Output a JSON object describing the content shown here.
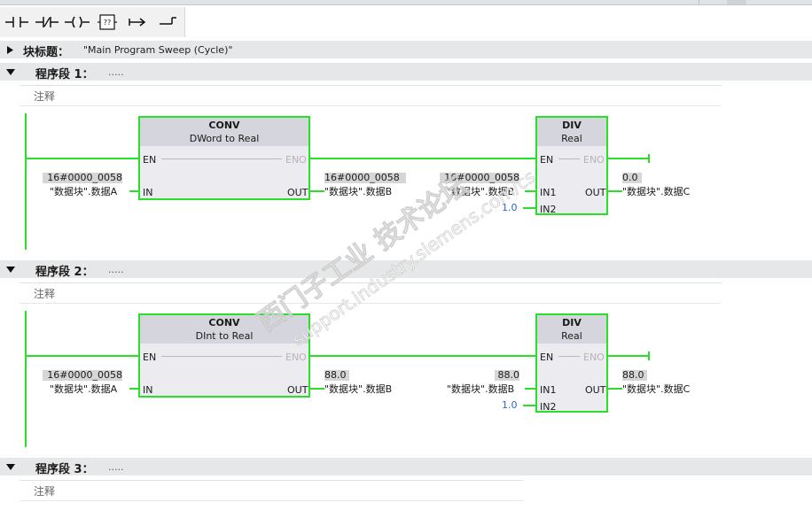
{
  "toolbar": {
    "buttons": [
      {
        "name": "no-contact-icon"
      },
      {
        "name": "nc-contact-icon"
      },
      {
        "name": "coil-icon"
      },
      {
        "name": "empty-box-icon"
      },
      {
        "name": "open-branch-icon"
      },
      {
        "name": "close-branch-icon"
      }
    ],
    "empty_box_glyph": "??"
  },
  "block_title": {
    "label": "块标题：",
    "value": "\"Main Program Sweep (Cycle)\""
  },
  "networks": [
    {
      "label": "程序段 1：",
      "dots": ".....",
      "comment": "注释",
      "conv": {
        "name": "CONV",
        "from": "DWord",
        "to_word": "to",
        "to": "Real",
        "en": "EN",
        "eno": "ENO",
        "in": "IN",
        "out": "OUT"
      },
      "conv_in_value": "16#0000_0058",
      "conv_in_tag": "\"数据块\".数据A",
      "conv_out_value": "16#0000_0058",
      "conv_out_tag": "\"数据块\".数据B",
      "div": {
        "name": "DIV",
        "type": "Real",
        "en": "EN",
        "eno": "ENO",
        "in1": "IN1",
        "in2": "IN2",
        "out": "OUT"
      },
      "div_in1_value": "16#0000_0058",
      "div_in1_tag": "\"数据块\".数据B",
      "div_in2_const": "1.0",
      "div_out_value": "0.0",
      "div_out_tag": "\"数据块\".数据C"
    },
    {
      "label": "程序段 2：",
      "dots": ".....",
      "comment": "注释",
      "conv": {
        "name": "CONV",
        "from": "DInt",
        "to_word": "to",
        "to": "Real",
        "en": "EN",
        "eno": "ENO",
        "in": "IN",
        "out": "OUT"
      },
      "conv_in_value": "16#0000_0058",
      "conv_in_tag": "\"数据块\".数据A",
      "conv_out_value": "88.0",
      "conv_out_tag": "\"数据块\".数据B",
      "div": {
        "name": "DIV",
        "type": "Real",
        "en": "EN",
        "eno": "ENO",
        "in1": "IN1",
        "in2": "IN2",
        "out": "OUT"
      },
      "div_in1_value": "88.0",
      "div_in1_tag": "\"数据块\".数据B",
      "div_in2_const": "1.0",
      "div_out_value": "88.0",
      "div_out_tag": "\"数据块\".数据C"
    },
    {
      "label": "程序段 3：",
      "dots": ".....",
      "comment": "注释"
    }
  ],
  "watermark": {
    "line1": "西门子工业 技术论坛",
    "line2": "support.industry.siemens.com/cs"
  },
  "colors": {
    "wire": "#27e027",
    "bar": "#e5e7e8",
    "constant": "#2e5fd6",
    "value_box": "#d6d6d6"
  }
}
